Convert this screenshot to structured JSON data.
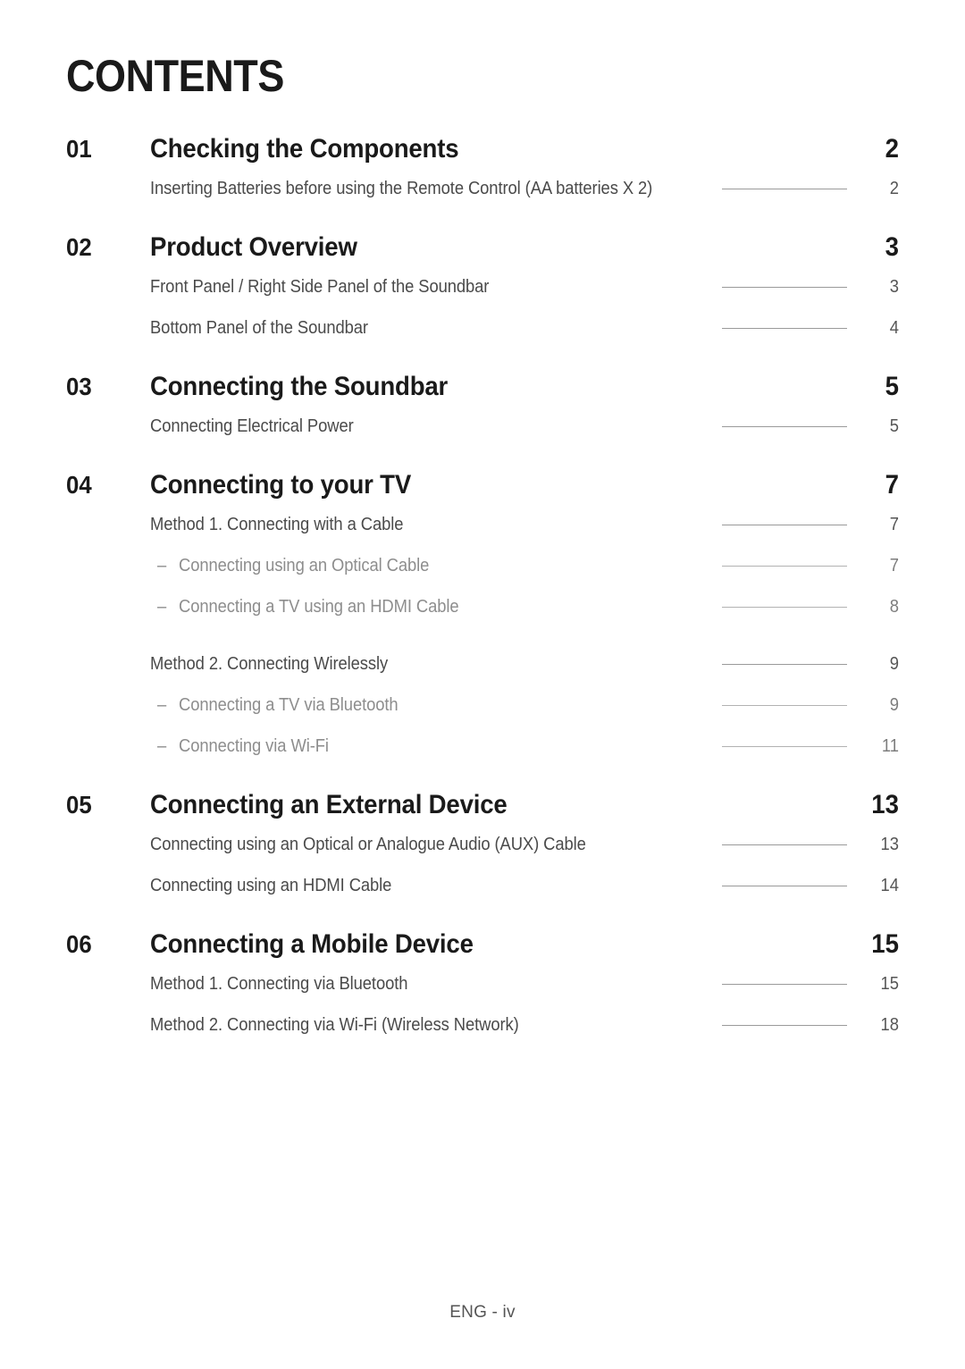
{
  "page": {
    "title": "CONTENTS",
    "footer": "ENG - iv"
  },
  "sections": [
    {
      "number": "01",
      "title": "Checking the Components",
      "page": "2",
      "entries": [
        {
          "level": 2,
          "label": "Inserting Batteries before using the Remote Control (AA batteries X 2)",
          "page": "2"
        }
      ]
    },
    {
      "number": "02",
      "title": "Product Overview",
      "page": "3",
      "entries": [
        {
          "level": 2,
          "label": "Front Panel / Right Side Panel of the Soundbar",
          "page": "3"
        },
        {
          "level": 2,
          "label": "Bottom Panel of the Soundbar",
          "page": "4"
        }
      ]
    },
    {
      "number": "03",
      "title": "Connecting the Soundbar",
      "page": "5",
      "entries": [
        {
          "level": 2,
          "label": "Connecting Electrical Power",
          "page": "5"
        }
      ]
    },
    {
      "number": "04",
      "title": "Connecting to your TV",
      "page": "7",
      "entries": [
        {
          "level": 2,
          "label": "Method 1. Connecting with a Cable",
          "page": "7"
        },
        {
          "level": 3,
          "dash": "–",
          "label": "Connecting using an Optical Cable",
          "page": "7"
        },
        {
          "level": 3,
          "dash": "–",
          "label": "Connecting a TV using an HDMI Cable",
          "page": "8"
        },
        {
          "level": 2,
          "label": "Method 2. Connecting Wirelessly",
          "page": "9",
          "group_gap": true
        },
        {
          "level": 3,
          "dash": "–",
          "label": "Connecting a TV via Bluetooth",
          "page": "9"
        },
        {
          "level": 3,
          "dash": "–",
          "label": "Connecting via Wi-Fi",
          "page": "11"
        }
      ]
    },
    {
      "number": "05",
      "title": "Connecting an External Device",
      "page": "13",
      "entries": [
        {
          "level": 2,
          "label": "Connecting using an Optical or Analogue Audio (AUX) Cable",
          "page": "13"
        },
        {
          "level": 2,
          "label": "Connecting using an HDMI Cable",
          "page": "14"
        }
      ]
    },
    {
      "number": "06",
      "title": "Connecting a Mobile Device",
      "page": "15",
      "entries": [
        {
          "level": 2,
          "label": "Method 1. Connecting via Bluetooth",
          "page": "15"
        },
        {
          "level": 2,
          "label": "Method 2. Connecting via Wi-Fi (Wireless Network)",
          "page": "18"
        }
      ]
    }
  ]
}
